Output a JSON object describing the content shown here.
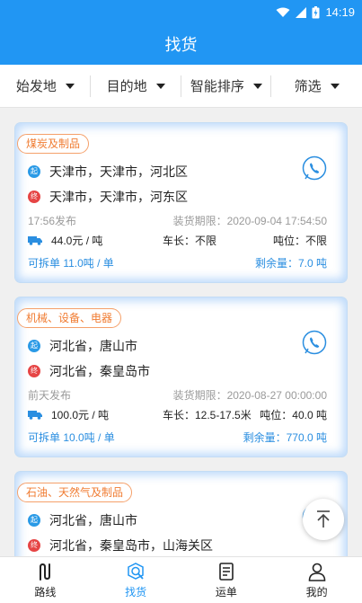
{
  "status": {
    "time": "14:19"
  },
  "header": {
    "title": "找货"
  },
  "filters": [
    {
      "label": "始发地"
    },
    {
      "label": "目的地"
    },
    {
      "label": "智能排序"
    },
    {
      "label": "筛选"
    }
  ],
  "cards": [
    {
      "tag": "煤炭及制品",
      "from": "天津市，天津市，河北区",
      "to": "天津市，天津市，河东区",
      "published": "17:56发布",
      "deadline": "装货期限：2020-09-04 17:54:50",
      "price": "44.0元 / 吨",
      "length": "车长：不限",
      "tonnage": "吨位：不限",
      "split": "可拆单   11.0吨 / 单",
      "remaining": "剩余量：7.0 吨"
    },
    {
      "tag": "机械、设备、电器",
      "from": "河北省，唐山市",
      "to": "河北省，秦皇岛市",
      "published": "前天发布",
      "deadline": "装货期限：2020-08-27 00:00:00",
      "price": "100.0元 / 吨",
      "length": "车长：12.5-17.5米",
      "tonnage": "吨位：40.0 吨",
      "split": "可拆单   10.0吨 / 单",
      "remaining": "剩余量：770.0 吨"
    },
    {
      "tag": "石油、天然气及制品",
      "from": "河北省，唐山市",
      "to": "河北省，秦皇岛市，山海关区"
    }
  ],
  "badges": {
    "start": "起",
    "end": "终"
  },
  "tabs": [
    {
      "label": "路线"
    },
    {
      "label": "找货"
    },
    {
      "label": "运单"
    },
    {
      "label": "我的"
    }
  ],
  "colors": {
    "primary": "#2196f3",
    "tag": "#f07c32",
    "start_dot": "#2a9ae6",
    "end_dot": "#e64545"
  }
}
